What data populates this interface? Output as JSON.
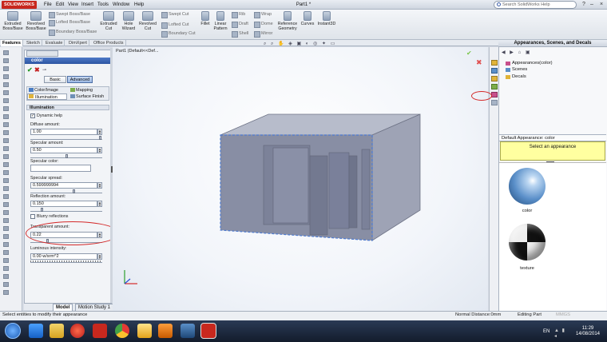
{
  "app": {
    "logo": "SOLIDWORKS",
    "title": "Part1 *",
    "menu": [
      "File",
      "Edit",
      "View",
      "Insert",
      "Tools",
      "Window",
      "Help"
    ],
    "search_placeholder": "Search SolidWorks Help"
  },
  "ribbon": {
    "big": [
      {
        "label": "Extruded Boss/Base"
      },
      {
        "label": "Revolved Boss/Base"
      },
      {
        "label": "Extruded Cut"
      },
      {
        "label": "Hole Wizard"
      },
      {
        "label": "Revolved Cut"
      },
      {
        "label": "Fillet"
      },
      {
        "label": "Linear Pattern"
      },
      {
        "label": "Reference Geometry"
      },
      {
        "label": "Curves"
      },
      {
        "label": "Instant3D"
      }
    ],
    "small": {
      "swept_boss": "Swept Boss/Base",
      "lofted_boss": "Lofted Boss/Base",
      "boundary_boss": "Boundary Boss/Base",
      "swept_cut": "Swept Cut",
      "lofted_cut": "Lofted Cut",
      "boundary_cut": "Boundary Cut",
      "rib": "Rib",
      "draft": "Draft",
      "shell": "Shell",
      "wrap": "Wrap",
      "dome": "Dome",
      "mirror": "Mirror"
    }
  },
  "tabs": [
    "Features",
    "Sketch",
    "Evaluate",
    "DimXpert",
    "Office Products"
  ],
  "property_manager": {
    "title": "color",
    "basic_label": "Basic",
    "advanced_label": "Advanced",
    "subtabs": [
      "Color/Image",
      "Mapping",
      "Illumination",
      "Surface Finish"
    ],
    "section_title": "Illumination",
    "dynamic_help": "Dynamic help",
    "fields": {
      "diffuse_label": "Diffuse amount:",
      "diffuse_value": "1.00",
      "specular_label": "Specular amount:",
      "specular_value": "0.50",
      "specular_color_label": "Specular color:",
      "specular_spread_label": "Specular spread:",
      "specular_spread_value": "0.599999994",
      "reflection_label": "Reflection amount:",
      "reflection_value": "0.150",
      "blurry_label": "Blurry reflections",
      "transparent_label": "Transparent amount:",
      "transparent_value": "0.22",
      "luminous_label": "Luminous intensity:",
      "luminous_value": "0.00 w/srm^2"
    },
    "bottom_tabs": [
      "Model",
      "Motion Study 1"
    ]
  },
  "viewport": {
    "doc_label": "Part1 (Default<<Def..."
  },
  "task_pane": {
    "title": "Appearances, Scenes, and Decals",
    "tree": [
      "Appearances(color)",
      "Scenes",
      "Decals"
    ],
    "default_appearance": "Default Appearance: color",
    "select_prompt": "Select an appearance",
    "swatches": [
      {
        "label": "color",
        "color": "#5a8fc9"
      },
      {
        "label": "texture",
        "color": "#222222"
      }
    ]
  },
  "status": {
    "left": "Select entities to modify their appearance",
    "normal_distance": "Normal Distance:0mm",
    "mode": "Editing Part",
    "units": "MMGS"
  },
  "taskbar": {
    "lang": "EN",
    "time": "11:29",
    "date": "14/08/2014"
  },
  "colors": {
    "accent": "#2d56a3",
    "highlight": "#ffffa0",
    "annotation": "#d42a2a"
  }
}
